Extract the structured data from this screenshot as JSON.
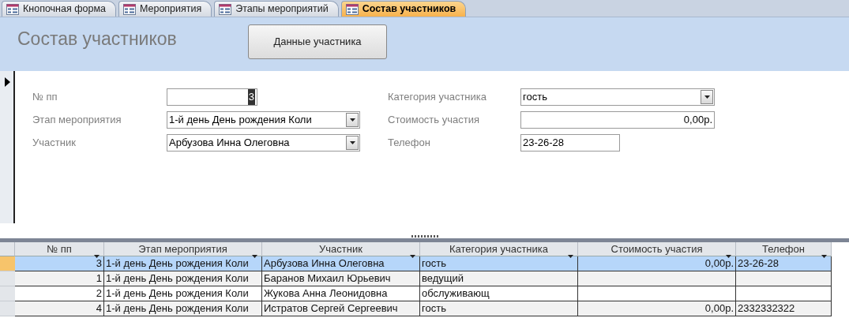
{
  "tabs": [
    {
      "label": "Кнопочная форма",
      "selected": false
    },
    {
      "label": "Мероприятия",
      "selected": false
    },
    {
      "label": "Этапы мероприятий",
      "selected": false
    },
    {
      "label": "Состав участников",
      "selected": true
    }
  ],
  "header": {
    "title": "Состав участников",
    "button": "Данные участника"
  },
  "form": {
    "left": [
      {
        "label": "№ пп",
        "value": "3",
        "kind": "number",
        "text_selected": true
      },
      {
        "label": "Этап мероприятия",
        "value": "1-й день День рождения Коли",
        "kind": "combo"
      },
      {
        "label": "Участник",
        "value": "Арбузова Инна Олеговна",
        "kind": "combo"
      }
    ],
    "right": [
      {
        "label": "Категория участника",
        "value": "гость",
        "kind": "combo"
      },
      {
        "label": "Стоимость участия",
        "value": "0,00р.",
        "kind": "number"
      },
      {
        "label": "Телефон",
        "value": "23-26-28",
        "kind": "text"
      }
    ]
  },
  "table": {
    "columns": [
      {
        "label": "№ пп"
      },
      {
        "label": "Этап мероприятия"
      },
      {
        "label": "Участник"
      },
      {
        "label": "Категория участника"
      },
      {
        "label": "Стоимость участия"
      },
      {
        "label": "Телефон"
      }
    ],
    "rows": [
      {
        "selected": true,
        "cells": {
          "n": "3",
          "stage": "1-й день День рождения Коли",
          "participant": "Арбузова Инна Олеговна",
          "category": "гость",
          "cost": "0,00р.",
          "phone": "23-26-28"
        }
      },
      {
        "selected": false,
        "cells": {
          "n": "1",
          "stage": "1-й день День рождения Коли",
          "participant": "Баранов Михаил Юрьевич",
          "category": "ведущий"
        }
      },
      {
        "selected": false,
        "cells": {
          "n": "2",
          "stage": "1-й день День рождения Коли",
          "participant": "Жукова Анна Леонидовна",
          "category": "обслуживающ"
        }
      },
      {
        "selected": false,
        "cells": {
          "n": "4",
          "stage": "1-й день День рождения Коли",
          "participant": "Истратов Сергей Сергеевич",
          "category": "гость",
          "cost": "0,00р.",
          "phone": "2332332322"
        }
      }
    ]
  }
}
